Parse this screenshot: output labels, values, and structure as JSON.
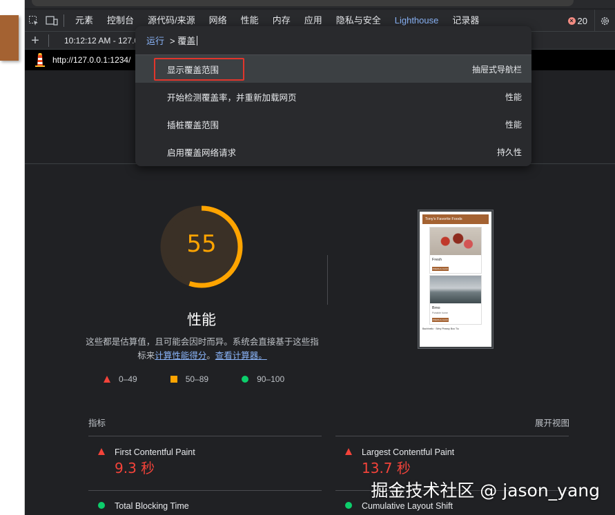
{
  "colors": {
    "background": "#202124",
    "accent": "#8ab4f8",
    "score_average": "#ffa400",
    "fail": "#f4433a",
    "pass": "#0cce6b",
    "highlight_box": "#e2352b",
    "brand_brown": "#a46232"
  },
  "toolbar": {
    "tabs": [
      "元素",
      "控制台",
      "源代码/来源",
      "网络",
      "性能",
      "内存",
      "应用",
      "隐私与安全",
      "Lighthouse",
      "记录器"
    ],
    "active_tab": "Lighthouse",
    "error_count": "20",
    "icons": [
      "inspect-icon",
      "device-toggle-icon",
      "settings-gear-icon",
      "error-icon"
    ]
  },
  "subbar": {
    "report_time": "10:12:12 AM - 127.0.",
    "url": "http://127.0.0.1:1234/"
  },
  "command_menu": {
    "run_label": "运行",
    "query": "> 覆盖",
    "items": [
      {
        "label": "显示覆盖范围",
        "category": "抽屉式导航栏"
      },
      {
        "label": "开始检测覆盖率，并重新加载网页",
        "category": "性能"
      },
      {
        "label": "插桩覆盖范围",
        "category": "性能"
      },
      {
        "label": "启用覆盖网络请求",
        "category": "持久性"
      }
    ]
  },
  "score": {
    "value": 55,
    "fraction": 0.55,
    "title": "性能",
    "description_prefix": "这些都是估算值，且可能会因时而异。系统会直接基于这些指标来",
    "link_calculated": "计算性能得分",
    "separator": "。",
    "link_calculator": "查看计算器。"
  },
  "legend": [
    {
      "range": "0–49",
      "icon": "fail-triangle-icon"
    },
    {
      "range": "50–89",
      "icon": "average-square-icon"
    },
    {
      "range": "90–100",
      "icon": "pass-circle-icon"
    }
  ],
  "thumbnail": {
    "page_title": "Tony's Favorite Foods",
    "items": [
      {
        "name": "Fresh",
        "sub": "",
        "button": "PRESS & CLICK"
      },
      {
        "name": "Brno",
        "sub": "Portable home",
        "button": "PRESS & CLICK"
      }
    ],
    "footer": "Bachinello · Sirby Pheasy Boo Tiu"
  },
  "metrics": {
    "heading": "指标",
    "expand_label": "展开视图",
    "items": [
      {
        "name": "First Contentful Paint",
        "value": "9.3 秒",
        "status": "fail"
      },
      {
        "name": "Largest Contentful Paint",
        "value": "13.7 秒",
        "status": "fail"
      },
      {
        "name": "Total Blocking Time",
        "value": "",
        "status": "pass"
      },
      {
        "name": "Cumulative Layout Shift",
        "value": "",
        "status": "pass"
      }
    ]
  },
  "watermark": "掘金技术社区 @ jason_yang"
}
